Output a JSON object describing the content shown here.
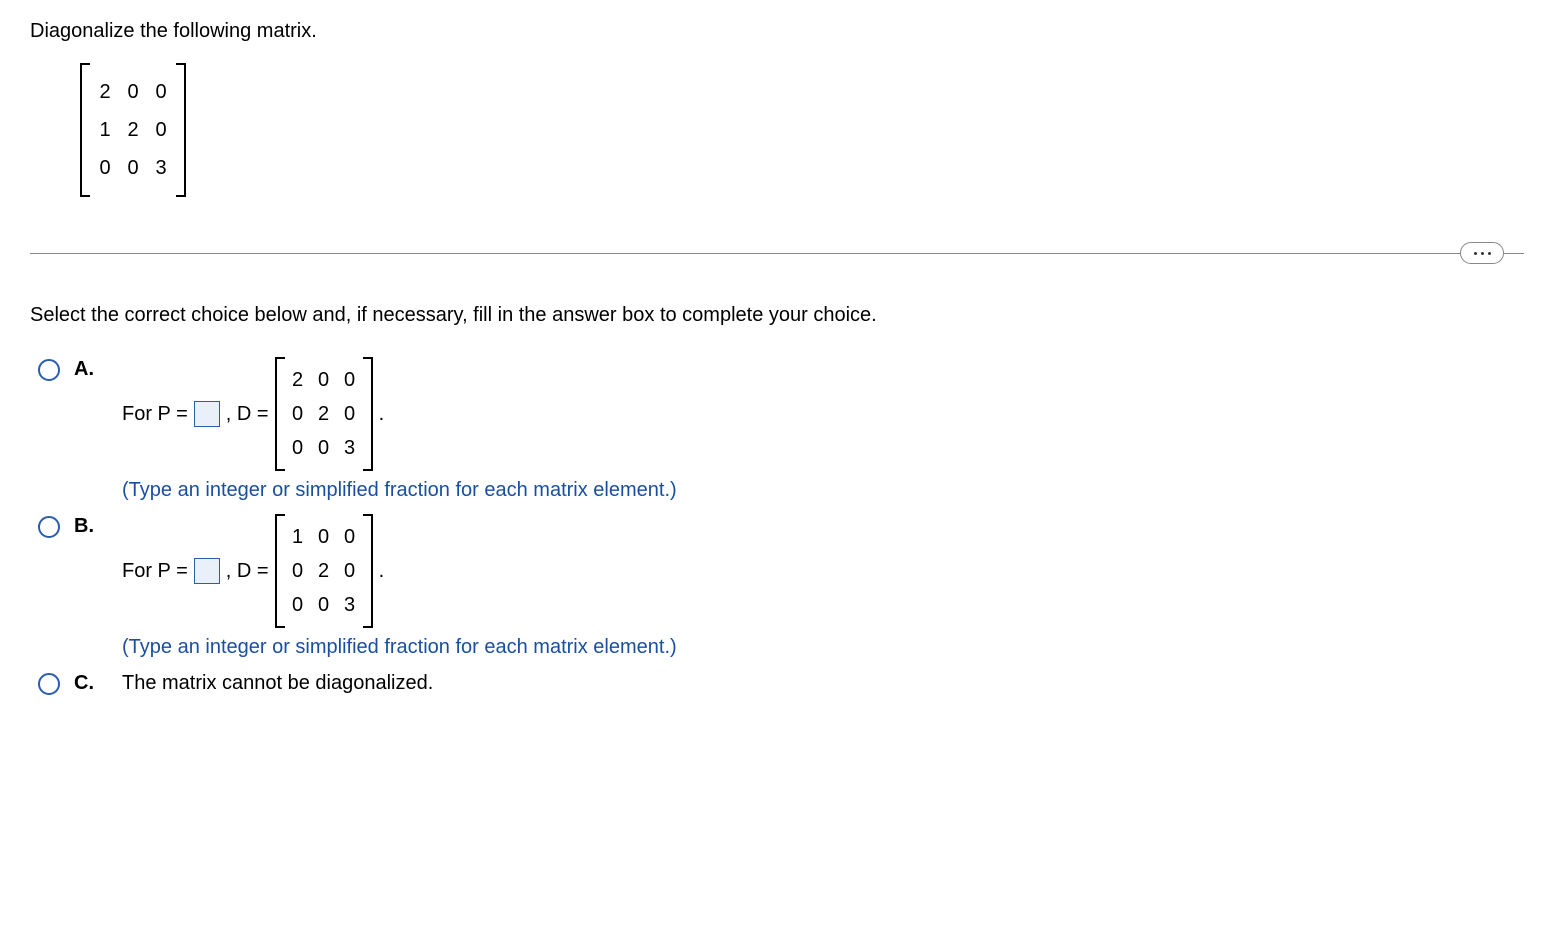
{
  "question": {
    "prompt": "Diagonalize the following matrix.",
    "matrix": {
      "r1c1": "2",
      "r1c2": "0",
      "r1c3": "0",
      "r2c1": "1",
      "r2c2": "2",
      "r2c3": "0",
      "r3c1": "0",
      "r3c2": "0",
      "r3c3": "3"
    }
  },
  "instruction": "Select the correct choice below and, if necessary, fill in the answer box to complete your choice.",
  "choices": {
    "a": {
      "label": "A.",
      "for_p": "For P =",
      "d_eq": ", D =",
      "period": ".",
      "matrix": {
        "r1c1": "2",
        "r1c2": "0",
        "r1c3": "0",
        "r2c1": "0",
        "r2c2": "2",
        "r2c3": "0",
        "r3c1": "0",
        "r3c2": "0",
        "r3c3": "3"
      },
      "hint": "(Type an integer or simplified fraction for each matrix element.)"
    },
    "b": {
      "label": "B.",
      "for_p": "For P =",
      "d_eq": ", D =",
      "period": ".",
      "matrix": {
        "r1c1": "1",
        "r1c2": "0",
        "r1c3": "0",
        "r2c1": "0",
        "r2c2": "2",
        "r2c3": "0",
        "r3c1": "0",
        "r3c2": "0",
        "r3c3": "3"
      },
      "hint": "(Type an integer or simplified fraction for each matrix element.)"
    },
    "c": {
      "label": "C.",
      "text": "The matrix cannot be diagonalized."
    }
  }
}
